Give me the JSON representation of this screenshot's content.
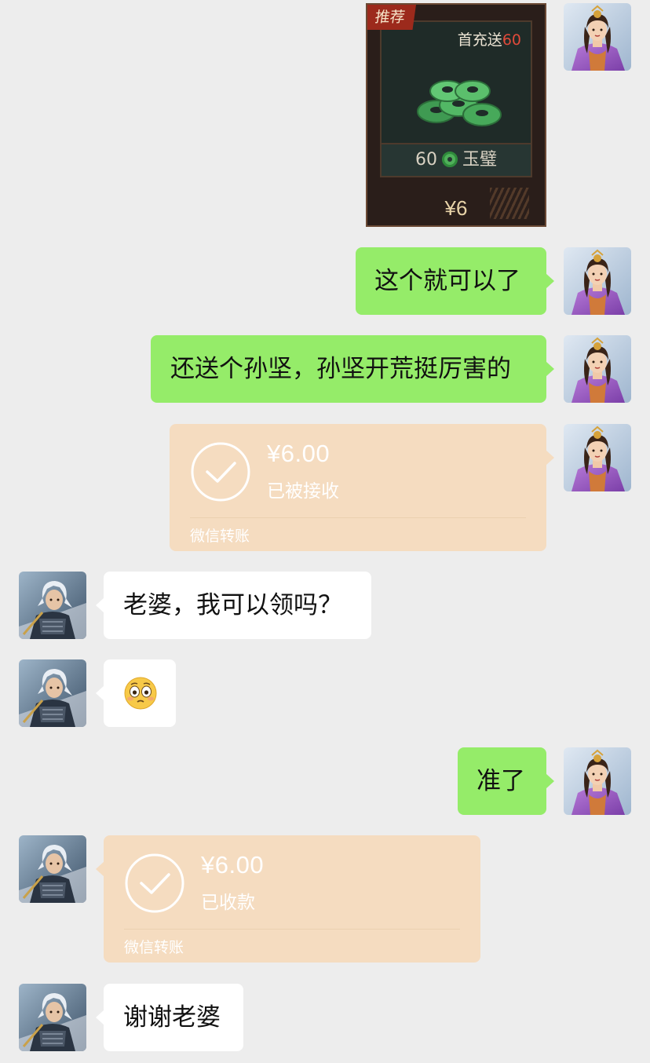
{
  "chat": {
    "game_card": {
      "tag": "推荐",
      "promo_prefix": "首充送",
      "promo_amount": "60",
      "item_count": "60",
      "item_name": "玉璧",
      "price": "¥6",
      "icon": "jade-coins-icon"
    },
    "messages": [
      {
        "side": "out",
        "type": "text",
        "text": "这个就可以了"
      },
      {
        "side": "out",
        "type": "text",
        "text": "还送个孙坚，孙坚开荒挺厉害的"
      },
      {
        "side": "out",
        "type": "transfer",
        "amount": "¥6.00",
        "status": "已被接收",
        "footer": "微信转账"
      },
      {
        "side": "in",
        "type": "text",
        "text": "老婆，我可以领吗？"
      },
      {
        "side": "in",
        "type": "emoji",
        "emoji": "flushed-face-icon"
      },
      {
        "side": "out",
        "type": "text",
        "text": "准了"
      },
      {
        "side": "in",
        "type": "transfer",
        "amount": "¥6.00",
        "status": "已收款",
        "footer": "微信转账"
      },
      {
        "side": "in",
        "type": "text",
        "text": "谢谢老婆"
      }
    ]
  },
  "colors": {
    "background": "#ededed",
    "outgoing_bubble": "#95ec69",
    "incoming_bubble": "#ffffff",
    "transfer_card": "#f5dcc0"
  }
}
